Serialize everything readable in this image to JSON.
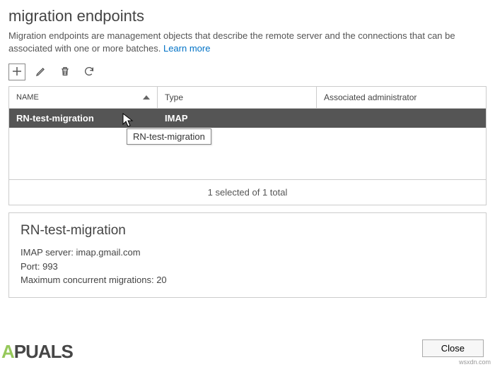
{
  "page": {
    "title": "migration endpoints",
    "description": "Migration endpoints are management objects that describe the remote server and the connections that can be associated with one or more batches.",
    "learn_more": "Learn more"
  },
  "table": {
    "headers": {
      "name": "NAME",
      "type": "Type",
      "admin": "Associated administrator"
    },
    "rows": [
      {
        "name": "RN-test-migration",
        "type": "IMAP",
        "admin": ""
      }
    ],
    "tooltip": "RN-test-migration",
    "status": "1 selected of 1 total"
  },
  "details": {
    "title": "RN-test-migration",
    "imap_label": "IMAP server:",
    "imap_value": "imap.gmail.com",
    "port_label": "Port:",
    "port_value": "993",
    "max_label": "Maximum concurrent migrations:",
    "max_value": "20"
  },
  "buttons": {
    "close": "Close"
  },
  "watermark": {
    "brand_a": "A",
    "brand_rest": "PUALS",
    "site": "wsxdn.com"
  }
}
